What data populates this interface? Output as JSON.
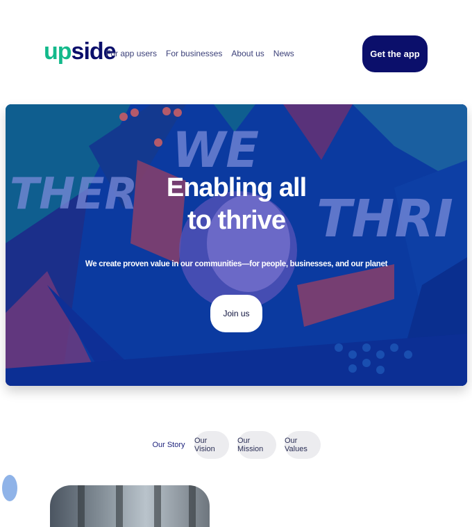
{
  "brand": {
    "logo_up": "up",
    "logo_side": "side",
    "accent": "#13b98b",
    "navy": "#0b0f6b"
  },
  "nav": {
    "links": [
      "For app users",
      "For businesses",
      "About us",
      "News"
    ],
    "cta": "Get the app"
  },
  "hero": {
    "title": "Enabling all\nto thrive",
    "subtitle": "We create proven value in our communities—for people, businesses, and our planet",
    "button": "Join us",
    "bg_words": {
      "left": "THER",
      "top": "WE",
      "right": "THRI"
    }
  },
  "tabs": [
    "Our Story",
    "Our Vision",
    "Our Mission",
    "Our Values"
  ],
  "active_tab": "Our Story"
}
